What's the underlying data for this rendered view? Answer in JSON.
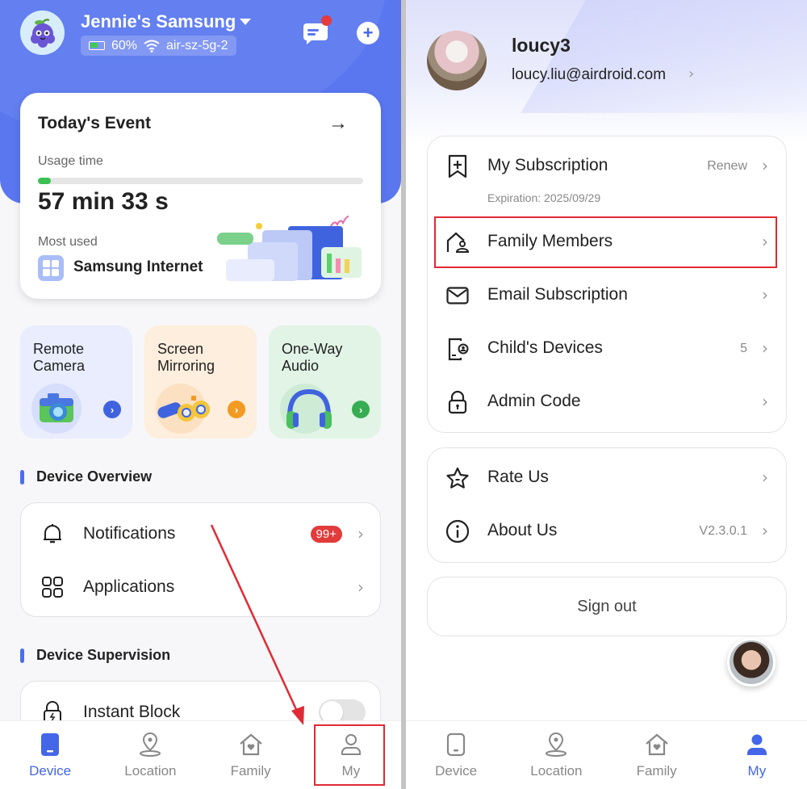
{
  "left_screen": {
    "header": {
      "device_name": "Jennie's Samsung",
      "battery": "60%",
      "wifi": "air-sz-5g-2",
      "icons": [
        "grape-avatar-icon",
        "dropdown-caret-icon",
        "battery-icon",
        "wifi-icon",
        "message-icon",
        "add-icon"
      ]
    },
    "todays_event": {
      "title": "Today's Event",
      "arrow": "→",
      "usage_label": "Usage time",
      "usage_progress_percent": 4,
      "usage_value": "57 min 33 s",
      "most_used_label": "Most used",
      "most_used_app": "Samsung Internet"
    },
    "tiles": [
      {
        "label": "Remote\nCamera",
        "bg": "#e9edfd",
        "accent": "#3f63df",
        "icon": "camera-icon"
      },
      {
        "label": "Screen\nMirroring",
        "bg": "#fdeedd",
        "accent": "#f29a22",
        "icon": "binoculars-icon"
      },
      {
        "label": "One-Way\nAudio",
        "bg": "#e1f4e6",
        "accent": "#36ad52",
        "icon": "headphones-icon"
      }
    ],
    "device_overview": {
      "title": "Device Overview",
      "items": [
        {
          "label": "Notifications",
          "badge": "99+",
          "icon": "bell-icon"
        },
        {
          "label": "Applications",
          "icon": "apps-grid-icon"
        }
      ]
    },
    "device_supervision": {
      "title": "Device Supervision",
      "items": [
        {
          "label": "Instant Block",
          "icon": "lock-bolt-icon",
          "toggle_on": false
        }
      ]
    },
    "tabbar": [
      {
        "label": "Device",
        "active": true
      },
      {
        "label": "Location",
        "active": false
      },
      {
        "label": "Family",
        "active": false
      },
      {
        "label": "My",
        "active": false,
        "highlighted": true
      }
    ]
  },
  "right_screen": {
    "profile": {
      "username": "loucy3",
      "email": "loucy.liu@airdroid.com"
    },
    "account_menu": [
      {
        "label": "My Subscription",
        "value": "Renew",
        "sub": "Expiration: 2025/09/29",
        "icon": "bookmark-plus-icon"
      },
      {
        "label": "Family Members",
        "value": "",
        "icon": "house-user-icon",
        "highlighted": true
      },
      {
        "label": "Email Subscription",
        "value": "",
        "icon": "mail-icon"
      },
      {
        "label": "Child's Devices",
        "value": "5",
        "icon": "device-user-icon"
      },
      {
        "label": "Admin Code",
        "value": "",
        "icon": "lock-icon"
      }
    ],
    "about_menu": [
      {
        "label": "Rate Us",
        "value": "",
        "icon": "star-icon"
      },
      {
        "label": "About Us",
        "value": "V2.3.0.1",
        "icon": "info-icon"
      }
    ],
    "sign_out": "Sign out",
    "tabbar": [
      {
        "label": "Device",
        "active": false
      },
      {
        "label": "Location",
        "active": false
      },
      {
        "label": "Family",
        "active": false
      },
      {
        "label": "My",
        "active": true
      }
    ]
  },
  "colors": {
    "brand_blue": "#5a77f0",
    "active_tab": "#4466e8",
    "highlight_red": "#e02a34",
    "badge_red": "#e23b3b",
    "progress_green": "#3cbf53"
  }
}
